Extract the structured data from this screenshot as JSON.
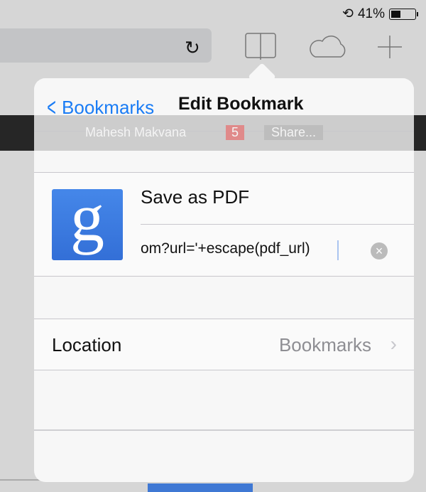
{
  "status_bar": {
    "battery_percent": "41%",
    "battery_level": 0.41
  },
  "toolbar": {
    "reload_icon": "reload-icon",
    "bookmarks_icon": "book-icon",
    "icloud_icon": "cloud-icon",
    "new_tab_icon": "plus-icon"
  },
  "background_page": {
    "user": "Mahesh Makvana",
    "badge": "5",
    "share": "Share..."
  },
  "popover": {
    "back_label": "Bookmarks",
    "title": "Edit Bookmark",
    "bookmark": {
      "name": "Save as PDF",
      "url": "om?url='+escape(pdf_url)"
    },
    "location_label": "Location",
    "location_value": "Bookmarks"
  }
}
